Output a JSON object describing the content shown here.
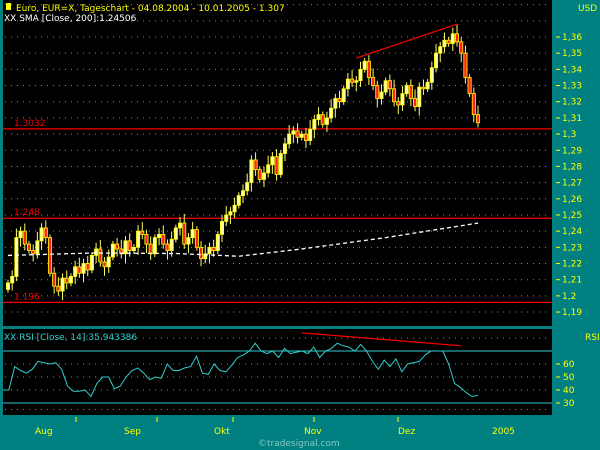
{
  "header": {
    "title": "Euro, EUR=X, Tageschart - 04.08.2004 - 10.01.2005 - 1.307",
    "sma_label": "XX SMA [Close, 200]:1.24506",
    "rsi_label": "XX RSI [Close, 14]:35.943386",
    "price_unit": "USD",
    "rsi_unit": "RSI",
    "watermark": "©tradesignal.com"
  },
  "colors": {
    "background": "#008080",
    "plot": "#000000",
    "up": "#ffff66",
    "down": "#ff0000",
    "rsi": "#33cccc",
    "sma": "#ffffff",
    "level": "#ff0000",
    "axis_text": "#ffff00"
  },
  "chart_data": [
    {
      "type": "candlestick",
      "title": "Euro, EUR=X, Tageschart",
      "ylabel": "USD",
      "ylim": [
        1.185,
        1.382
      ],
      "yticks": [
        "1,19",
        "1,2",
        "1,21",
        "1,22",
        "1,23",
        "1,24",
        "1,25",
        "1,26",
        "1,27",
        "1,28",
        "1,29",
        "1,3",
        "1,31",
        "1,32",
        "1,33",
        "1,34",
        "1,35",
        "1,36"
      ],
      "ytick_values": [
        1.19,
        1.2,
        1.21,
        1.22,
        1.23,
        1.24,
        1.25,
        1.26,
        1.27,
        1.28,
        1.29,
        1.3,
        1.31,
        1.32,
        1.33,
        1.34,
        1.35,
        1.36
      ],
      "xticks": [
        "Aug",
        "Sep",
        "Okt",
        "Nov",
        "Dez",
        "2005"
      ],
      "close": [
        1.208,
        1.212,
        1.236,
        1.24,
        1.232,
        1.228,
        1.226,
        1.234,
        1.242,
        1.236,
        1.214,
        1.206,
        1.203,
        1.211,
        1.208,
        1.212,
        1.218,
        1.214,
        1.22,
        1.216,
        1.225,
        1.229,
        1.221,
        1.218,
        1.224,
        1.232,
        1.229,
        1.226,
        1.234,
        1.228,
        1.23,
        1.24,
        1.238,
        1.232,
        1.226,
        1.236,
        1.238,
        1.232,
        1.228,
        1.235,
        1.242,
        1.245,
        1.232,
        1.236,
        1.241,
        1.23,
        1.223,
        1.226,
        1.23,
        1.228,
        1.238,
        1.246,
        1.25,
        1.252,
        1.256,
        1.262,
        1.265,
        1.27,
        1.284,
        1.278,
        1.272,
        1.276,
        1.281,
        1.286,
        1.275,
        1.288,
        1.294,
        1.3,
        1.302,
        1.298,
        1.3,
        1.296,
        1.303,
        1.309,
        1.312,
        1.306,
        1.31,
        1.316,
        1.322,
        1.32,
        1.328,
        1.334,
        1.332,
        1.333,
        1.34,
        1.345,
        1.335,
        1.33,
        1.322,
        1.326,
        1.333,
        1.328,
        1.32,
        1.318,
        1.325,
        1.33,
        1.322,
        1.317,
        1.329,
        1.328,
        1.332,
        1.341,
        1.35,
        1.354,
        1.358,
        1.356,
        1.362,
        1.357,
        1.35,
        1.335,
        1.325,
        1.312,
        1.307
      ],
      "sma200": {
        "bar_index": [
          0,
          20,
          40,
          55,
          70,
          90,
          112
        ],
        "value": [
          1.225,
          1.2265,
          1.2262,
          1.2245,
          1.229,
          1.236,
          1.245
        ]
      },
      "levels": [
        {
          "label": "1.3032",
          "value": 1.3032
        },
        {
          "label": "1.248",
          "value": 1.248
        },
        {
          "label": "1.196",
          "value": 1.196
        }
      ],
      "trendline": {
        "bar_index": [
          83,
          107
        ],
        "value": [
          1.347,
          1.368
        ]
      }
    },
    {
      "type": "line",
      "title": "RSI [Close, 14]",
      "ylabel": "RSI",
      "ylim": [
        18,
        90
      ],
      "yticks": [
        "30",
        "40",
        "50",
        "60"
      ],
      "ytick_values": [
        30,
        40,
        50,
        60
      ],
      "bands": [
        30,
        70
      ],
      "values": [
        40,
        40,
        58,
        55,
        53,
        56,
        62,
        61,
        60,
        61,
        56,
        43,
        39,
        39,
        40,
        35,
        45,
        50,
        50,
        41,
        43,
        50,
        55,
        57,
        53,
        48,
        50,
        49,
        60,
        55,
        55,
        57,
        58,
        66,
        53,
        52,
        60,
        55,
        54,
        59,
        65,
        67,
        70,
        76,
        70,
        68,
        70,
        65,
        72,
        68,
        69,
        70,
        68,
        73,
        65,
        70,
        72,
        76,
        74,
        73,
        70,
        75,
        70,
        62,
        56,
        63,
        58,
        64,
        54,
        60,
        61,
        62,
        67,
        70,
        70,
        70,
        60,
        45,
        42,
        38,
        35,
        36
      ],
      "trendline": {
        "bar_index": [
          70,
          108
        ],
        "value": [
          84,
          74
        ]
      }
    }
  ]
}
